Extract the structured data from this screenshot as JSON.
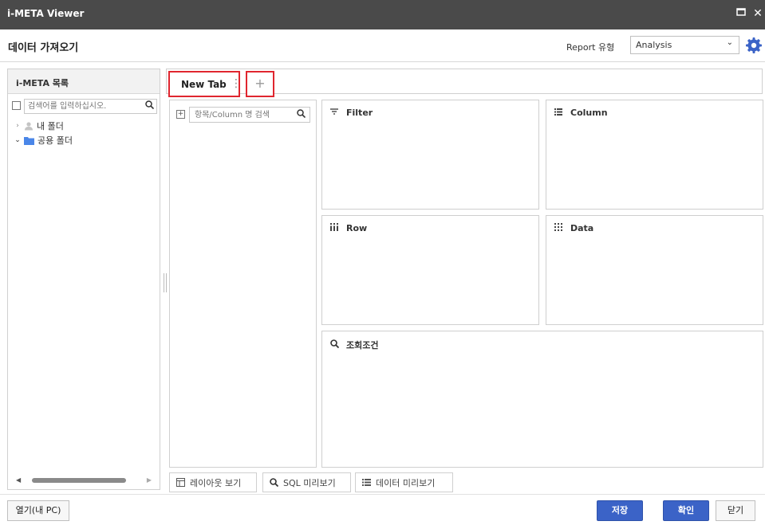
{
  "window": {
    "title": "i-META Viewer",
    "maximize_icon": "maximize-icon",
    "close_icon": "close-icon"
  },
  "header": {
    "title": "데이터 가져오기",
    "report_type_label": "Report 유형",
    "report_type_value": "Analysis",
    "settings_icon": "gear-icon",
    "accent_color": "#3b63c7"
  },
  "left_panel": {
    "title": "i-META 목록",
    "search_placeholder": "검색어를 입력하십시오.",
    "tree": [
      {
        "label": "내 폴더",
        "icon": "user-icon",
        "expanded": false
      },
      {
        "label": "공용 폴더",
        "icon": "folder-icon",
        "expanded": true
      }
    ]
  },
  "tabs": {
    "items": [
      {
        "label": "New Tab"
      }
    ],
    "add_label": "+",
    "highlight_color": "#e0262f"
  },
  "column_search": {
    "placeholder": "항목/Column 명 검색"
  },
  "zones": {
    "filter": "Filter",
    "column": "Column",
    "row": "Row",
    "data": "Data",
    "condition": "조회조건"
  },
  "bottom_buttons": {
    "layout": "레이아웃 보기",
    "sql": "SQL 미리보기",
    "data_preview": "데이터 미리보기"
  },
  "footer": {
    "open_pc": "열기(내 PC)",
    "save": "저장",
    "confirm": "확인",
    "close": "닫기"
  }
}
